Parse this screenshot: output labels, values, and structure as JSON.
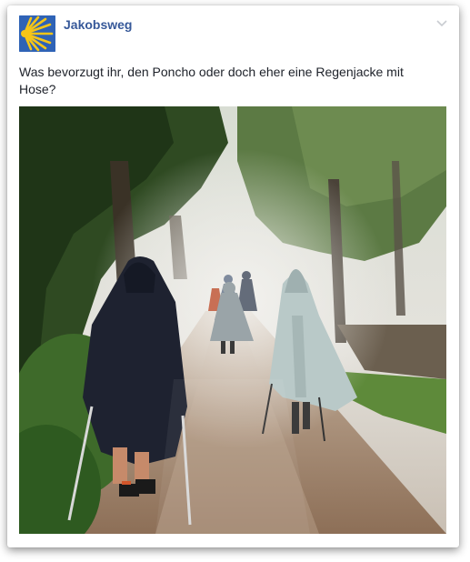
{
  "post": {
    "page_name": "Jakobsweg",
    "text": "Was bevorzugt ihr, den Poncho oder doch eher eine Regenjacke mit Hose?"
  },
  "icons": {
    "avatar": "scallop-shell-icon",
    "menu": "chevron-down-icon"
  },
  "colors": {
    "link_blue": "#365899",
    "avatar_blue": "#2f63b6",
    "shell_yellow": "#f5c518"
  }
}
